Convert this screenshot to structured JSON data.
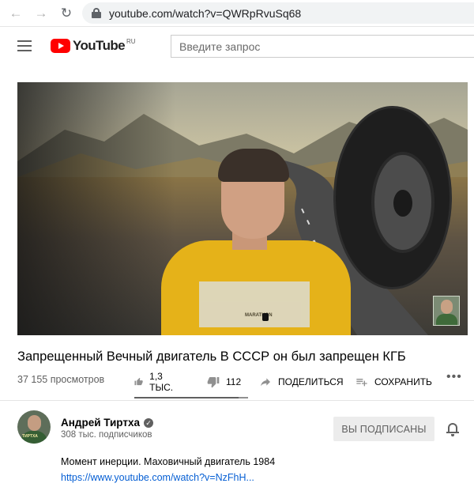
{
  "browser": {
    "back_icon": "←",
    "forward_icon": "→",
    "reload_icon": "↻",
    "url": "youtube.com/watch?v=QWRpRvuSq68"
  },
  "header": {
    "logo_text": "YouTube",
    "region": "RU",
    "search_placeholder": "Введите запрос"
  },
  "video": {
    "shirt_print": "MARATHON",
    "title": "Запрещенный Вечный двигатель В СССР он был запрещен КГБ",
    "views": "37 155 просмотров",
    "likes": "1,3 ТЫС.",
    "dislikes": "112",
    "share_label": "ПОДЕЛИТЬСЯ",
    "save_label": "СОХРАНИТЬ",
    "more_label": "•••",
    "like_ratio": 0.92
  },
  "channel": {
    "name": "Андрей Тиртха",
    "verified_mark": "✓",
    "avatar_text": "ТИРТХА",
    "subscribers": "308 тыс. подписчиков",
    "subscribed_label": "ВЫ ПОДПИСАНЫ"
  },
  "description": {
    "text": "Момент инерции. Маховичный двигатель 1984",
    "link": "https://www.youtube.com/watch?v=NzFhH..."
  },
  "colors": {
    "brand_red": "#ff0000",
    "link_blue": "#065fd4",
    "shirt_yellow": "#e5b219"
  }
}
